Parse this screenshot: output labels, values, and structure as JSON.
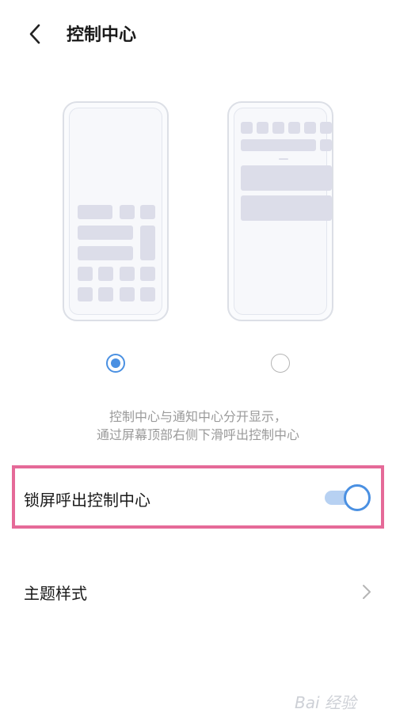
{
  "header": {
    "title": "控制中心"
  },
  "layout_options": {
    "selected_index": 0,
    "options": [
      {
        "name": "combined",
        "selected": true
      },
      {
        "name": "separate",
        "selected": false
      }
    ]
  },
  "description": {
    "line1": "控制中心与通知中心分开显示，",
    "line2": "通过屏幕顶部右侧下滑呼出控制中心"
  },
  "settings": {
    "lockscreen_label": "锁屏呼出控制中心",
    "lockscreen_enabled": true,
    "theme_label": "主题样式"
  },
  "watermark": {
    "text": "Bai 经验"
  },
  "colors": {
    "accent": "#4a90e2",
    "highlight_border": "#e56a98",
    "tile": "#dcdde9"
  },
  "icons": {
    "back": "chevron-left-icon",
    "theme_arrow": "chevron-right-icon"
  }
}
